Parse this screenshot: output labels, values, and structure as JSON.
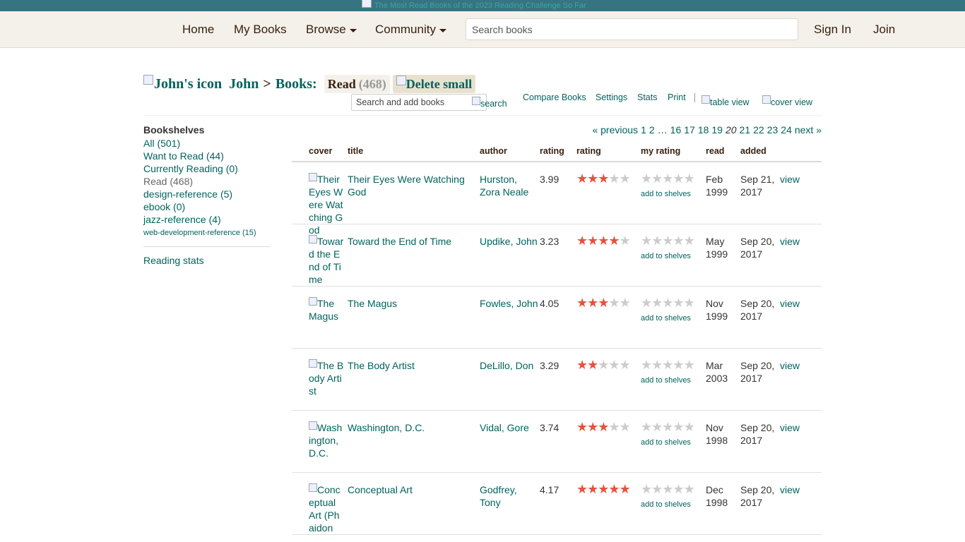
{
  "banner": {
    "alt_text": "The Most Read Books of the 2023 Reading Challenge So Far"
  },
  "nav": {
    "home": "Home",
    "my_books": "My Books",
    "browse": "Browse",
    "community": "Community",
    "search_placeholder": "Search books",
    "sign_in": "Sign In",
    "join": "Join"
  },
  "title": {
    "user_icon_alt": "John's icon",
    "user_name": "John",
    "sep": ">",
    "books_label": "Books:",
    "shelf_name": "Read",
    "shelf_count": "(468)",
    "delete_alt": "Delete small"
  },
  "toolbar": {
    "search_placeholder": "Search and add books",
    "search_btn": "search",
    "compare": "Compare Books",
    "settings": "Settings",
    "stats": "Stats",
    "print": "Print",
    "table_view": "table view",
    "cover_view": "cover view"
  },
  "sidebar": {
    "heading": "Bookshelves",
    "shelves": [
      {
        "label": "All (501)"
      },
      {
        "label": "Want to Read (44)"
      },
      {
        "label": "Currently Reading (0)"
      },
      {
        "label": "Read (468)"
      },
      {
        "label": "design-reference (5)"
      },
      {
        "label": "ebook (0)"
      },
      {
        "label": "jazz-reference (4)"
      },
      {
        "label": "web-development-reference (15)"
      }
    ],
    "reading_stats": "Reading stats"
  },
  "pagination": {
    "previous": "« previous",
    "p1": "1",
    "p2": "2",
    "ellipsis": "…",
    "p16": "16",
    "p17": "17",
    "p18": "18",
    "p19": "19",
    "current": "20",
    "p21": "21",
    "p22": "22",
    "p23": "23",
    "p24": "24",
    "next": "next »"
  },
  "table": {
    "headers": {
      "cover": "cover",
      "title": "title",
      "author": "author",
      "avg_rating": "rating",
      "rating": "rating",
      "my_rating": "my rating",
      "read": "read",
      "added": "added"
    },
    "add_to_shelves": "add to shelves",
    "view": "view",
    "rows": [
      {
        "cover_alt": "Their Eyes Were Watching God",
        "title": "Their Eyes Were Watching God",
        "author": "Hurston, Zora Neale",
        "avg": "3.99",
        "stars": 3,
        "read": "Feb 1999",
        "added": "Sep 21, 2017"
      },
      {
        "cover_alt": "Toward the End of Time",
        "title": "Toward the End of Time",
        "author": "Updike, John",
        "avg": "3.23",
        "stars": 4,
        "read": "May 1999",
        "added": "Sep 20, 2017"
      },
      {
        "cover_alt": "The Magus",
        "title": "The Magus",
        "author": "Fowles, John",
        "avg": "4.05",
        "stars": 3,
        "read": "Nov 1999",
        "added": "Sep 20, 2017"
      },
      {
        "cover_alt": "The Body Artist",
        "title": "The Body Artist",
        "author": "DeLillo, Don",
        "avg": "3.29",
        "stars": 2,
        "read": "Mar 2003",
        "added": "Sep 20, 2017"
      },
      {
        "cover_alt": "Washington, D.C.",
        "title": "Washington, D.C.",
        "author": "Vidal, Gore",
        "avg": "3.74",
        "stars": 3,
        "read": "Nov 1998",
        "added": "Sep 20, 2017"
      },
      {
        "cover_alt": "Conceptual Art (Phaidon",
        "title": "Conceptual Art",
        "author": "Godfrey, Tony",
        "avg": "4.17",
        "stars": 5,
        "read": "Dec 1998",
        "added": "Sep 20, 2017"
      }
    ]
  },
  "colors": {
    "brand_teal": "#00635d",
    "header_bg": "#f4f1ea",
    "banner_bg": "#377481",
    "star_on": "#e8513c",
    "star_off": "#cccccc"
  }
}
